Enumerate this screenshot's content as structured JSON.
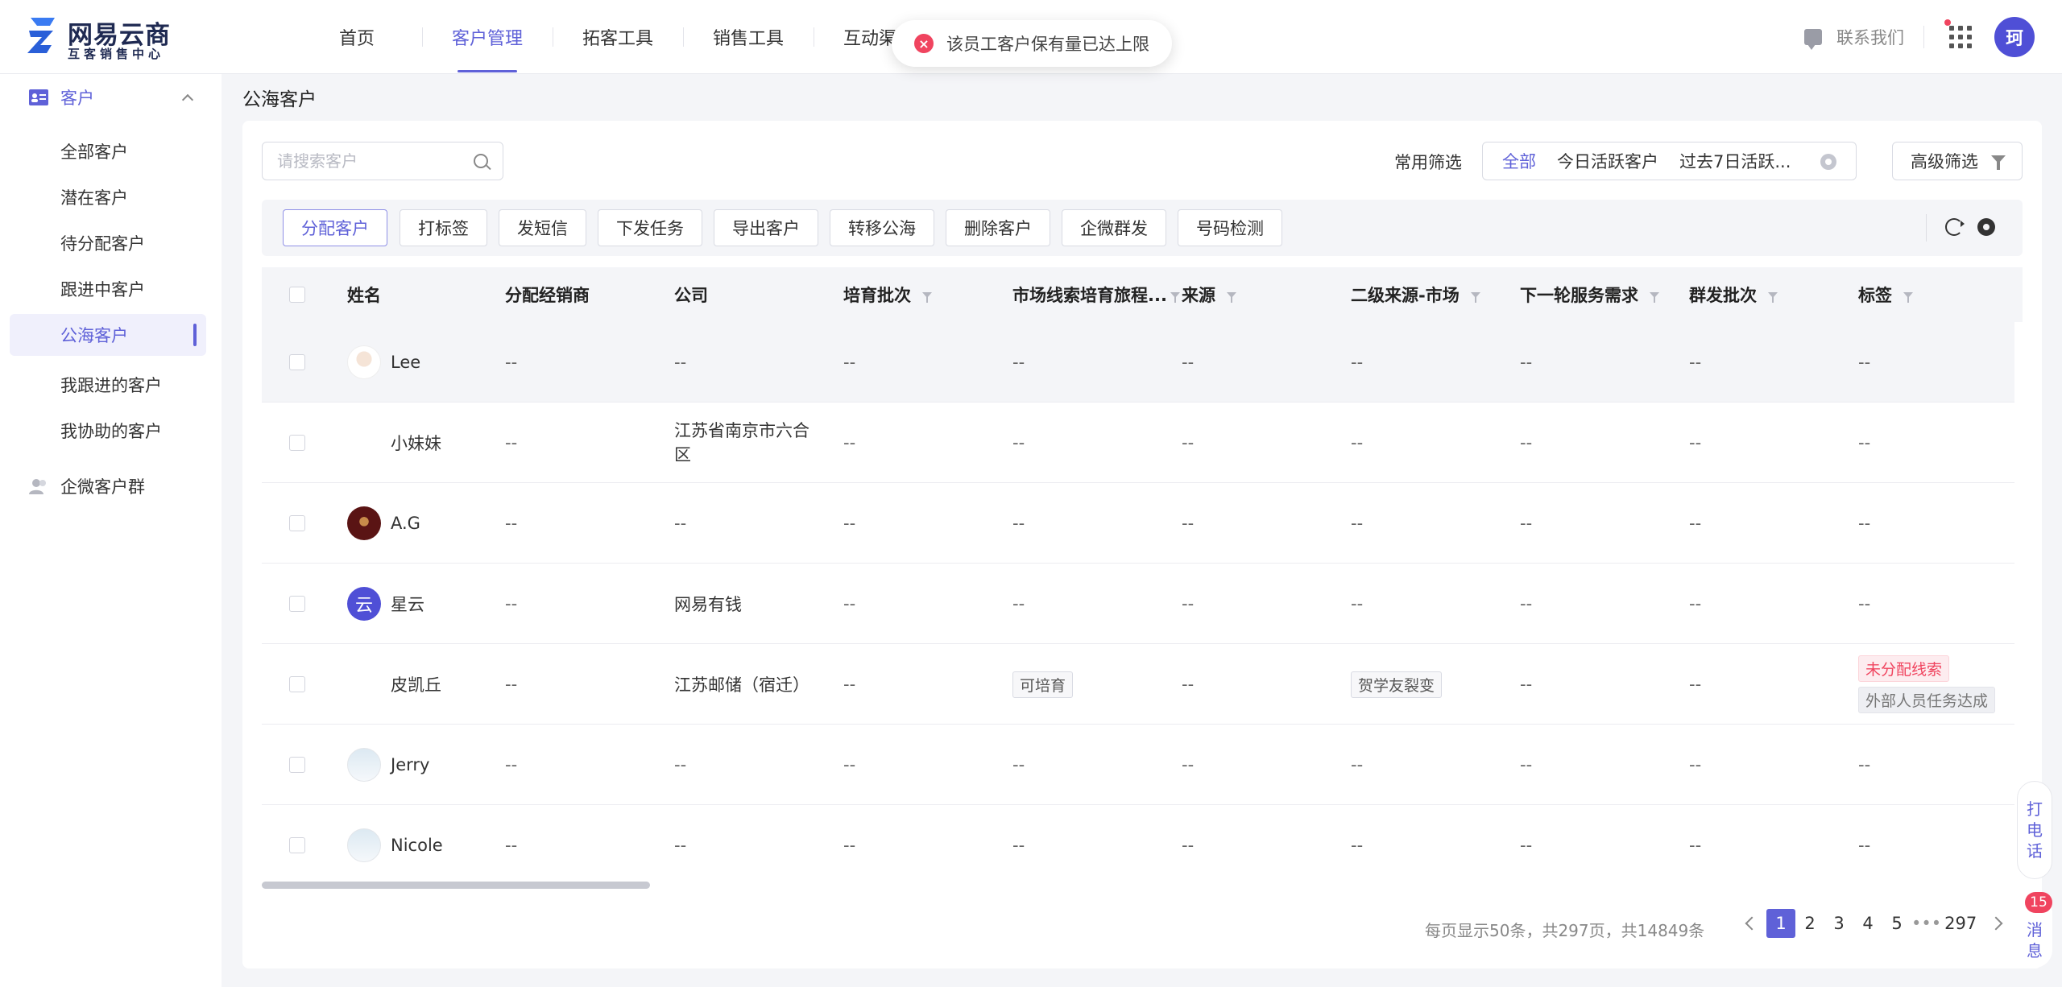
{
  "brand": {
    "name": "网易云商",
    "subtitle": "互客销售中心"
  },
  "nav": [
    {
      "label": "首页"
    },
    {
      "label": "客户管理"
    },
    {
      "label": "拓客工具"
    },
    {
      "label": "销售工具"
    },
    {
      "label": "互动渠道"
    }
  ],
  "toast": {
    "message": "该员工客户保有量已达上限"
  },
  "header": {
    "contact_label": "联系我们",
    "avatar_text": "珂"
  },
  "sidebar": {
    "group_customer": "客户",
    "items": [
      {
        "label": "全部客户"
      },
      {
        "label": "潜在客户"
      },
      {
        "label": "待分配客户"
      },
      {
        "label": "跟进中客户"
      },
      {
        "label": "公海客户"
      },
      {
        "label": "我跟进的客户"
      },
      {
        "label": "我协助的客户"
      }
    ],
    "group_wecom": "企微客户群"
  },
  "page_title": "公海客户",
  "search": {
    "placeholder": "请搜索客户"
  },
  "filters": {
    "label": "常用筛选",
    "options": [
      "全部",
      "今日活跃客户",
      "过去7日活跃..."
    ],
    "advanced": "高级筛选"
  },
  "actions": [
    "分配客户",
    "打标签",
    "发短信",
    "下发任务",
    "导出客户",
    "转移公海",
    "删除客户",
    "企微群发",
    "号码检测"
  ],
  "table": {
    "columns": [
      "姓名",
      "分配经销商",
      "公司",
      "培育批次",
      "市场线索培育旅程...",
      "来源",
      "二级来源-市场",
      "下一轮服务需求",
      "群发批次",
      "标签"
    ],
    "rows": [
      {
        "name": "Lee",
        "dealer": "--",
        "company": "--",
        "batch": "--",
        "journey": "--",
        "source": "--",
        "sub_source": "--",
        "need": "--",
        "mass_batch": "--",
        "tags": "--"
      },
      {
        "name": "小妹妹",
        "dealer": "--",
        "company": "江苏省南京市六合区",
        "batch": "--",
        "journey": "--",
        "source": "--",
        "sub_source": "--",
        "need": "--",
        "mass_batch": "--",
        "tags": "--"
      },
      {
        "name": "A.G",
        "dealer": "--",
        "company": "--",
        "batch": "--",
        "journey": "--",
        "source": "--",
        "sub_source": "--",
        "need": "--",
        "mass_batch": "--",
        "tags": "--"
      },
      {
        "name": "星云",
        "avatar_text": "云",
        "dealer": "--",
        "company": "网易有钱",
        "batch": "--",
        "journey": "--",
        "source": "--",
        "sub_source": "--",
        "need": "--",
        "mass_batch": "--",
        "tags": "--"
      },
      {
        "name": "皮凯丘",
        "dealer": "--",
        "company": "江苏邮储（宿迁）",
        "batch": "--",
        "journey": "可培育",
        "source": "--",
        "sub_source": "贺学友裂变",
        "need": "--",
        "mass_batch": "--",
        "tag1": "未分配线索",
        "tag2": "外部人员任务达成"
      },
      {
        "name": "Jerry",
        "dealer": "--",
        "company": "--",
        "batch": "--",
        "journey": "--",
        "source": "--",
        "sub_source": "--",
        "need": "--",
        "mass_batch": "--",
        "tags": "--"
      },
      {
        "name": "Nicole",
        "dealer": "--",
        "company": "--",
        "batch": "--",
        "journey": "--",
        "source": "--",
        "sub_source": "--",
        "need": "--",
        "mass_batch": "--",
        "tags": "--"
      }
    ]
  },
  "pagination": {
    "info": "每页显示50条，共297页，共14849条",
    "pages": [
      "1",
      "2",
      "3",
      "4",
      "5",
      "•••",
      "297"
    ],
    "current": "1"
  },
  "float": {
    "call": [
      "打",
      "电",
      "话"
    ],
    "msg": [
      "消",
      "息"
    ],
    "msg_count": "15"
  },
  "colors": {
    "accent": "#5f61d8",
    "danger": "#f0445f",
    "background": "#f4f5f8"
  }
}
